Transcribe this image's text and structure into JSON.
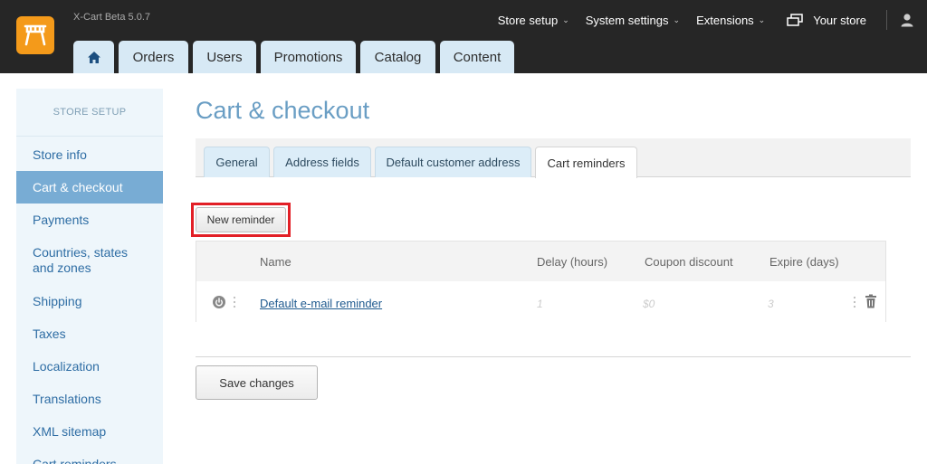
{
  "header": {
    "version": "X-Cart Beta 5.0.7",
    "nav": [
      {
        "label": "Store setup",
        "icon": "chevron-down-icon"
      },
      {
        "label": "System settings",
        "icon": "chevron-down-icon"
      },
      {
        "label": "Extensions",
        "icon": "chevron-down-icon"
      },
      {
        "label": "Your store",
        "icon": "store-window-icon"
      }
    ],
    "tabs": [
      "Orders",
      "Users",
      "Promotions",
      "Catalog",
      "Content"
    ],
    "colors": {
      "bar": "#262626",
      "tab": "#d7e9f5",
      "logo": "#f49a1a"
    }
  },
  "sidebar": {
    "heading": "STORE SETUP",
    "items": [
      {
        "label": "Store info"
      },
      {
        "label": "Cart & checkout",
        "active": true
      },
      {
        "label": "Payments"
      },
      {
        "label": "Countries, states and zones"
      },
      {
        "label": "Shipping"
      },
      {
        "label": "Taxes"
      },
      {
        "label": "Localization"
      },
      {
        "label": "Translations"
      },
      {
        "label": "XML sitemap"
      },
      {
        "label": "Cart reminders"
      }
    ]
  },
  "main": {
    "title": "Cart & checkout",
    "subtabs": [
      "General",
      "Address fields",
      "Default customer address",
      "Cart reminders"
    ],
    "active_subtab": "Cart reminders",
    "new_button": "New reminder",
    "table": {
      "columns": [
        "Name",
        "Delay (hours)",
        "Coupon discount",
        "Expire (days)"
      ],
      "rows": [
        {
          "name": "Default e-mail reminder",
          "delay": "1",
          "coupon": "$0",
          "expire": "3"
        }
      ]
    },
    "save_button": "Save changes"
  }
}
